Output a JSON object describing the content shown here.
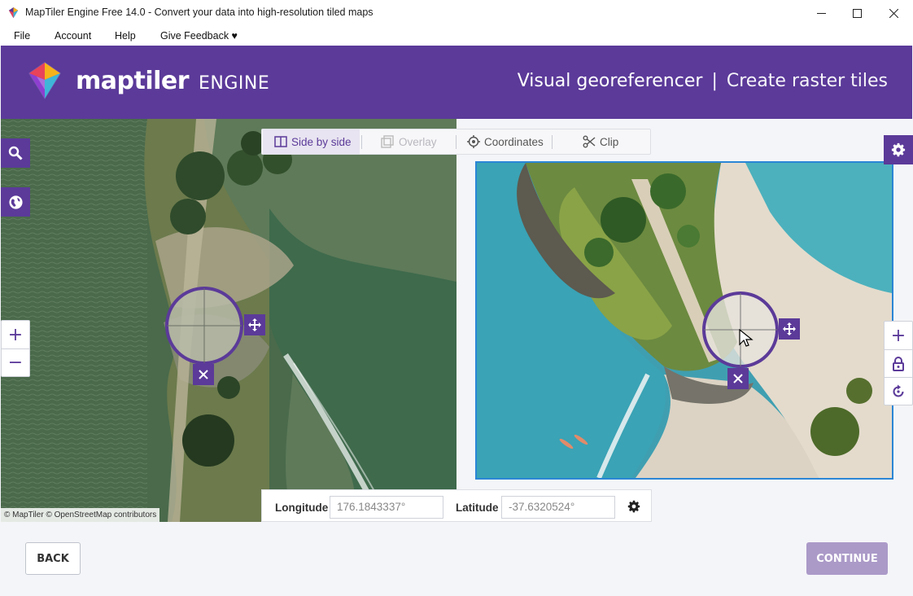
{
  "window": {
    "title": "MapTiler Engine Free 14.0 - Convert your data into high-resolution tiled maps",
    "controls": [
      "minimize-icon",
      "maximize-icon",
      "close-icon"
    ]
  },
  "menu": {
    "items": [
      {
        "label": "File"
      },
      {
        "label": "Account"
      },
      {
        "label": "Help"
      },
      {
        "label": "Give Feedback ♥"
      }
    ]
  },
  "header": {
    "logo_word": "maptiler",
    "logo_product": "ENGINE",
    "title_main": "Visual georeferencer",
    "title_sep": "|",
    "title_sub": "Create raster tiles"
  },
  "modes": {
    "side_by_side": "Side by side",
    "overlay": "Overlay",
    "coordinates": "Coordinates",
    "clip": "Clip",
    "active": "side_by_side"
  },
  "left_map": {
    "controls": [
      "search-icon",
      "globe-icon"
    ],
    "zoom_in": "+",
    "zoom_out": "−",
    "attribution": "© MapTiler © OpenStreetMap contributors"
  },
  "right_image": {
    "controls": [
      "zoom-in",
      "lock-icon",
      "rotate-icon"
    ],
    "zoom_in": "+"
  },
  "coordinates": {
    "longitude_label": "Longitude",
    "longitude_value": "176.1843337°",
    "latitude_label": "Latitude",
    "latitude_value": "-37.6320524°"
  },
  "footer": {
    "back": "BACK",
    "continue": "CONTINUE"
  },
  "colors": {
    "brand": "#5b3a99",
    "selection_border": "#2b86d6",
    "continue_disabled": "#ab9ac8"
  }
}
